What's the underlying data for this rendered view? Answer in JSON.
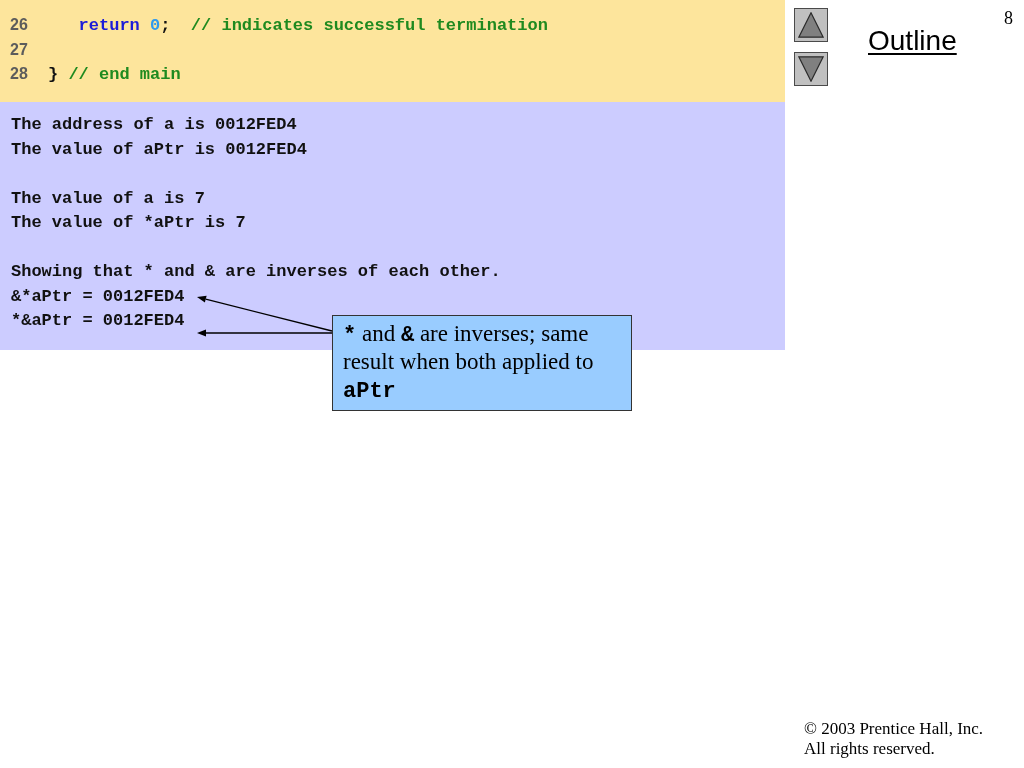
{
  "code_listing": {
    "lines": [
      {
        "number": "26",
        "indented": true,
        "tokens": [
          {
            "kind": "keyword",
            "text": "return "
          },
          {
            "kind": "number",
            "text": "0"
          },
          {
            "kind": "plain",
            "text": ";  "
          },
          {
            "kind": "comment",
            "text": "// indicates successful termination"
          }
        ]
      },
      {
        "number": "27"
      },
      {
        "number": "28",
        "indented": false,
        "tokens": [
          {
            "kind": "plain",
            "text": "} "
          },
          {
            "kind": "comment",
            "text": "// end main"
          }
        ]
      }
    ]
  },
  "program_output": {
    "paragraphs": [
      [
        "The address of a is 0012FED4",
        "The value of aPtr is 0012FED4"
      ],
      [
        "The value of a is 7",
        "The value of *aPtr is 7"
      ],
      [
        "Showing that * and & are inverses of each other.",
        "&*aPtr = 0012FED4",
        "*&aPtr = 0012FED4"
      ]
    ]
  },
  "callout": {
    "segments": [
      {
        "kind": "code",
        "text": "*"
      },
      {
        "kind": "text",
        "text": " and "
      },
      {
        "kind": "code",
        "text": "&"
      },
      {
        "kind": "text",
        "text": " are inverses; same result when both applied to "
      },
      {
        "kind": "code",
        "text": "aPtr"
      }
    ]
  },
  "outline_link": "Outline",
  "page_number": "8",
  "footer": {
    "copyright": "© 2003 Prentice Hall, Inc.",
    "rights": "All rights reserved."
  }
}
